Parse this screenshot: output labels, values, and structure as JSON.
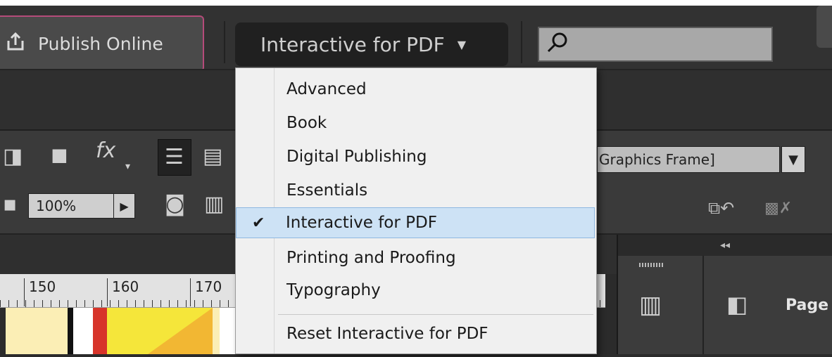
{
  "toolbar": {
    "publish_label": "Publish Online",
    "workspace_label": "Interactive for PDF",
    "search_value": ""
  },
  "control_panel": {
    "fx_label": "fx",
    "zoom_value": "100%",
    "object_style_value": "Graphics Frame]"
  },
  "ruler": {
    "labels": [
      "150",
      "160",
      "170"
    ]
  },
  "workspace_menu": {
    "items": [
      {
        "label": "Advanced",
        "checked": false
      },
      {
        "label": "Book",
        "checked": false
      },
      {
        "label": "Digital Publishing",
        "checked": false
      },
      {
        "label": "Essentials",
        "checked": false
      },
      {
        "label": "Interactive for PDF",
        "checked": true
      },
      {
        "label": "Printing and Proofing",
        "checked": false
      },
      {
        "label": "Typography",
        "checked": false
      }
    ],
    "reset_label": "Reset Interactive for PDF"
  },
  "panels": {
    "pages_label": "Page"
  },
  "colors": {
    "menu_bg": "#f0f0f0",
    "menu_selected": "#cde2f5",
    "publish_border": "#b54b7a",
    "app_bg": "#323232"
  }
}
